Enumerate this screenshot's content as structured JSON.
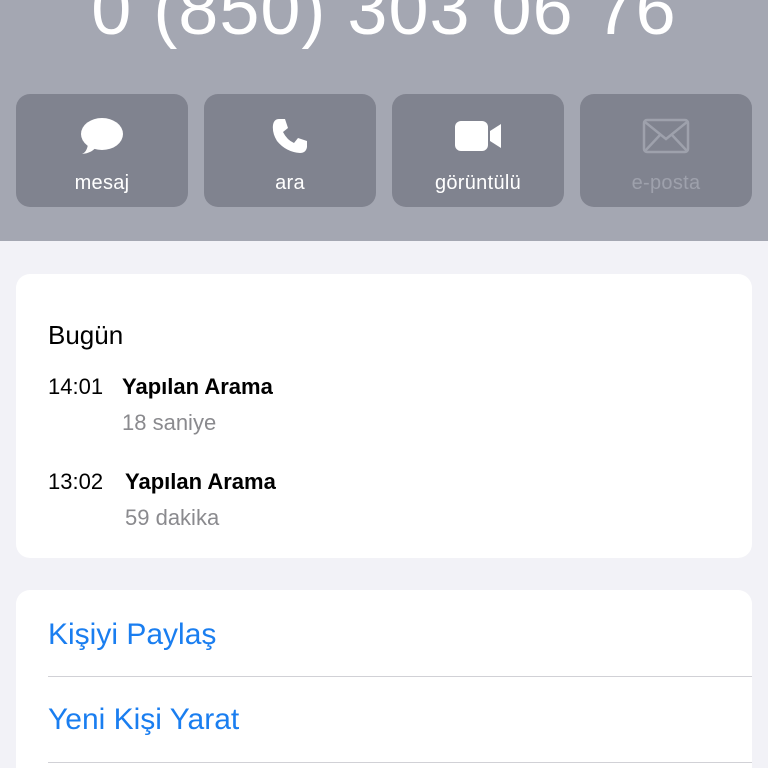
{
  "contact": {
    "phone_number": "0 (850) 303 06 76"
  },
  "quick_actions": [
    {
      "label": "mesaj",
      "icon": "message-bubble-icon",
      "enabled": true
    },
    {
      "label": "ara",
      "icon": "phone-icon",
      "enabled": true
    },
    {
      "label": "görüntülü",
      "icon": "video-camera-icon",
      "enabled": true
    },
    {
      "label": "e-posta",
      "icon": "envelope-icon",
      "enabled": false
    }
  ],
  "recents": {
    "day": "Bugün",
    "calls": [
      {
        "time": "14:01",
        "type": "Yapılan Arama",
        "duration": "18 saniye"
      },
      {
        "time": "13:02",
        "type": "Yapılan Arama",
        "duration": "59 dakika"
      }
    ]
  },
  "contact_actions": {
    "share_label": "Kişiyi Paylaş",
    "create_label": "Yeni Kişi Yarat"
  },
  "colors": {
    "header_bg": "#a4a7b2",
    "button_bg": "#80838f",
    "link_blue": "#1a7ef0",
    "secondary_text": "#8a8a8e",
    "page_bg": "#f2f2f7"
  }
}
